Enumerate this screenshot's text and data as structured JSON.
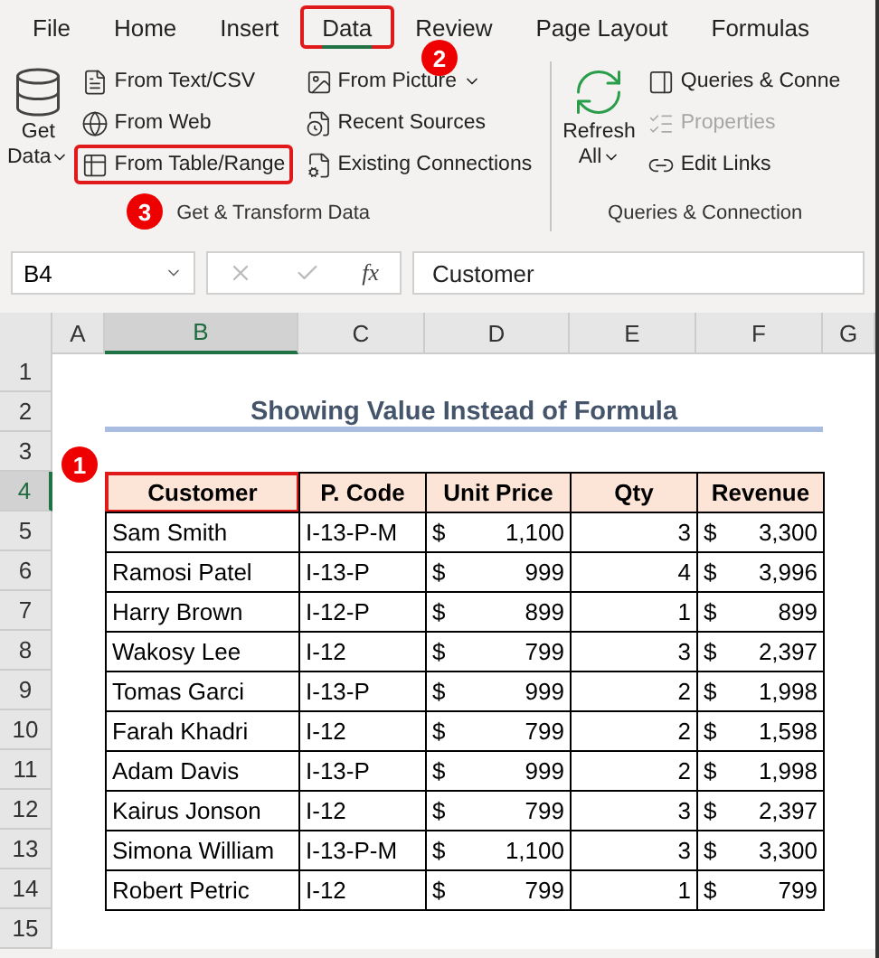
{
  "menu_tabs": [
    {
      "label": "File",
      "selected": false,
      "highlighted": false
    },
    {
      "label": "Home",
      "selected": false,
      "highlighted": false
    },
    {
      "label": "Insert",
      "selected": false,
      "highlighted": false
    },
    {
      "label": "Data",
      "selected": true,
      "highlighted": true
    },
    {
      "label": "Review",
      "selected": false,
      "highlighted": false
    },
    {
      "label": "Page Layout",
      "selected": false,
      "highlighted": false
    },
    {
      "label": "Formulas",
      "selected": false,
      "highlighted": false
    }
  ],
  "ribbon": {
    "groups": [
      {
        "label": "Get & Transform Data",
        "big_button": {
          "kind": "database",
          "lines": [
            "Get",
            "Data"
          ]
        },
        "columns": [
          [
            {
              "kind": "text-file",
              "label": "From Text/CSV",
              "highlighted": false,
              "disabled": false
            },
            {
              "kind": "web",
              "label": "From Web",
              "highlighted": false,
              "disabled": false
            },
            {
              "kind": "table",
              "label": "From Table/Range",
              "highlighted": true,
              "disabled": false
            }
          ],
          [
            {
              "kind": "picture",
              "label": "From Picture",
              "highlighted": false,
              "disabled": false,
              "dropdown": true
            },
            {
              "kind": "recent",
              "label": "Recent Sources",
              "highlighted": false,
              "disabled": false
            },
            {
              "kind": "connection",
              "label": "Existing Connections",
              "highlighted": false,
              "disabled": false
            }
          ]
        ]
      },
      {
        "label": "Queries & Connection",
        "big_button": {
          "kind": "refresh",
          "lines": [
            "Refresh",
            "All"
          ]
        },
        "columns": [
          [
            {
              "kind": "panel",
              "label": "Queries & Conne",
              "highlighted": false,
              "disabled": false
            },
            {
              "kind": "properties",
              "label": "Properties",
              "highlighted": false,
              "disabled": true
            },
            {
              "kind": "links",
              "label": "Edit Links",
              "highlighted": false,
              "disabled": false
            }
          ]
        ]
      }
    ]
  },
  "formula_bar": {
    "name_box": "B4",
    "fx": "fx",
    "content": "Customer"
  },
  "sheet": {
    "columns": [
      {
        "label": "A",
        "selected": false
      },
      {
        "label": "B",
        "selected": true
      },
      {
        "label": "C",
        "selected": false
      },
      {
        "label": "D",
        "selected": false
      },
      {
        "label": "E",
        "selected": false
      },
      {
        "label": "F",
        "selected": false
      },
      {
        "label": "G",
        "selected": false
      }
    ],
    "row_numbers": [
      {
        "label": "1",
        "selected": false
      },
      {
        "label": "2",
        "selected": false
      },
      {
        "label": "3",
        "selected": false
      },
      {
        "label": "4",
        "selected": true
      },
      {
        "label": "5",
        "selected": false
      },
      {
        "label": "6",
        "selected": false
      },
      {
        "label": "7",
        "selected": false
      },
      {
        "label": "8",
        "selected": false
      },
      {
        "label": "9",
        "selected": false
      },
      {
        "label": "10",
        "selected": false
      },
      {
        "label": "11",
        "selected": false
      },
      {
        "label": "12",
        "selected": false
      },
      {
        "label": "13",
        "selected": false
      },
      {
        "label": "14",
        "selected": false
      },
      {
        "label": "15",
        "selected": false
      }
    ],
    "title": "Showing Value Instead of Formula",
    "table": {
      "columns": [
        {
          "label": "Customer",
          "selected": true
        },
        {
          "label": "P. Code",
          "selected": false
        },
        {
          "label": "Unit Price",
          "selected": false
        },
        {
          "label": "Qty",
          "selected": false
        },
        {
          "label": "Revenue",
          "selected": false
        }
      ],
      "rows": [
        {
          "customer": "Sam Smith",
          "code": "I-13-P-M",
          "price": [
            "$",
            "1,100"
          ],
          "qty": "3",
          "revenue": [
            "$",
            "3,300"
          ]
        },
        {
          "customer": "Ramosi Patel",
          "code": "I-13-P",
          "price": [
            "$",
            "999"
          ],
          "qty": "4",
          "revenue": [
            "$",
            "3,996"
          ]
        },
        {
          "customer": "Harry Brown",
          "code": "I-12-P",
          "price": [
            "$",
            "899"
          ],
          "qty": "1",
          "revenue": [
            "$",
            "899"
          ]
        },
        {
          "customer": "Wakosy Lee",
          "code": "I-12",
          "price": [
            "$",
            "799"
          ],
          "qty": "3",
          "revenue": [
            "$",
            "2,397"
          ]
        },
        {
          "customer": "Tomas Garci",
          "code": "I-13-P",
          "price": [
            "$",
            "999"
          ],
          "qty": "2",
          "revenue": [
            "$",
            "1,998"
          ]
        },
        {
          "customer": "Farah Khadri",
          "code": "I-12",
          "price": [
            "$",
            "799"
          ],
          "qty": "2",
          "revenue": [
            "$",
            "1,598"
          ]
        },
        {
          "customer": "Adam Davis",
          "code": "I-13-P",
          "price": [
            "$",
            "999"
          ],
          "qty": "2",
          "revenue": [
            "$",
            "1,998"
          ]
        },
        {
          "customer": "Kairus Jonson",
          "code": "I-12",
          "price": [
            "$",
            "799"
          ],
          "qty": "3",
          "revenue": [
            "$",
            "2,397"
          ]
        },
        {
          "customer": "Simona William",
          "code": "I-13-P-M",
          "price": [
            "$",
            "1,100"
          ],
          "qty": "3",
          "revenue": [
            "$",
            "3,300"
          ]
        },
        {
          "customer": "Robert Petric",
          "code": "I-12",
          "price": [
            "$",
            "799"
          ],
          "qty": "1",
          "revenue": [
            "$",
            "799"
          ]
        }
      ]
    }
  },
  "step_badges": [
    "1",
    "2",
    "3"
  ]
}
